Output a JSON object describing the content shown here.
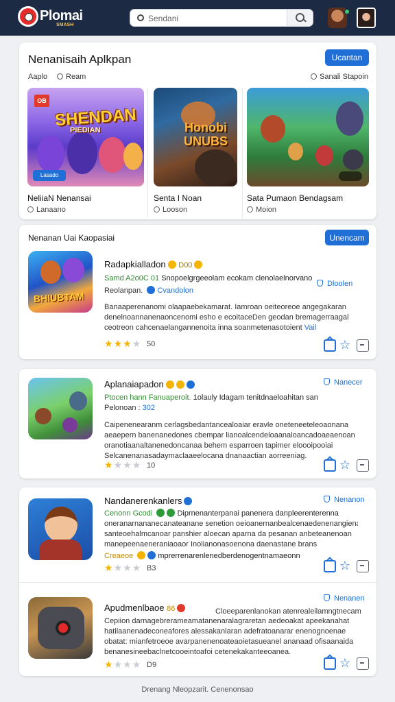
{
  "header": {
    "brand": "Plomai",
    "brand_sub": "SMASH",
    "search_placeholder": "Sendani"
  },
  "featured": {
    "title": "Nenanisaih Aplkpan",
    "button": "Ucantan",
    "meta_left": "Aaplo",
    "meta_left2": "Ream",
    "meta_right": "Sanali Stapoin",
    "items": [
      {
        "art_title": "SHENDAN",
        "art_sub": "PIEDIAN",
        "badge": "OB",
        "chip": "Lasado",
        "name": "NeliiaN Nenansai",
        "sub": "Lanaano"
      },
      {
        "art_title": "Honobi UNUBS",
        "name": "Senta I Noan",
        "sub": "Looson"
      },
      {
        "name": "Sata Pumaon Bendagsam",
        "sub": "Moion"
      }
    ]
  },
  "section": {
    "title": "Nenanan Uai Kaopasiai",
    "button": "Unencam"
  },
  "apps": [
    {
      "icon_text": "BHIUBTAM",
      "title": "Radapkialladon",
      "count_badge": "D00",
      "green_line": "Samd A2o0C 01",
      "green_rest": "Snopoelgrgeeolam ecokam clenolaelnorvano",
      "sub_line": "Reolanpan.",
      "sub_link": "Cvandolon",
      "tag": "Dloolen",
      "desc": [
        "Banaaperenanomi olaapaebekamarat. Iamroan oeiteoreoe angegakaran",
        "denelnoannanenaoncenomi esho e ecoitaceDen geodan bremagerraagal",
        "ceotreon cahcenaelangannenoita inna soanmetenasotoient"
      ],
      "desc_link": "Vail",
      "rating": 3,
      "count": "50"
    },
    {
      "title": "Aplanaiapadon",
      "green_line": "Ptocen hann Fanuaperoit.",
      "green_rest": "1olauly Idagam tenitdnaeloahitan san",
      "sub_line": "Pelonoan  :",
      "sub_link": "302",
      "tag": "Nanecer",
      "desc": [
        "Caipenenearanm cerlagsbedantancealoaiar eravle oneteneeteleoaonana",
        "aeaepern banenanedones cbempar lianoalcendeloaanaloancadoaeaenoan",
        "oranotiaanaltanenedoncanaa behem esparroen tapimer eloooipooiai",
        "Selcanenanasadaymaclaaeelocana dnanaactian aorreeniag."
      ],
      "rating": 1,
      "count": "10"
    },
    {
      "title": "Nandanerenkanlers",
      "green_line": "Cenonn Gcodi",
      "green_rest": "Diprnenanterpanai panenera danpleerenterenna",
      "tag": "Nenanon",
      "desc": [
        "oneranarnananecanateanane senetion oeioanernanbealcenaedenenangienann",
        "santeoehalmcanoar panshier aloecan aparna da pesanan anbeteanenoan",
        "manepeenaeneraniaoaor Inolianonasoenona daenastane brans"
      ],
      "green_line2": "Creaeoe",
      "green_rest2": "mprerrenarenlenedberdenogentnamaeonn",
      "rating": 1,
      "count": "B3"
    },
    {
      "title": "Apudmenlbaoe",
      "title_badge": "86",
      "green_rest": "Cloeeparenlanokan atenrealeilamngtnecam",
      "tag": "Nenanen",
      "desc": [
        "Cepiion darnagebrerameamatanenaralagraretan aedeoakat apeekanahat",
        "hatilaanenadeconeafores alessakanlaran adefratoanarar enenognoenae",
        "obatat: mianfetroeoe avarpanenenoateaoietasueanel ananaad ofisaanaida",
        "benanesineebaclnetcooeintoafoi cetenekakanteeoanea."
      ],
      "rating": 1,
      "count": "D9"
    }
  ],
  "footer": "Drenang Nleopzarit.  Cenenonsao"
}
